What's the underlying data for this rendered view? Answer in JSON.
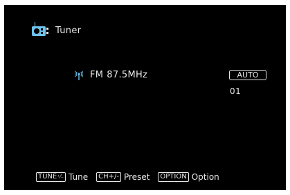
{
  "header": {
    "title": "Tuner",
    "icon": "radio-icon"
  },
  "station": {
    "band": "FM",
    "frequency": "87.5MHz",
    "icon": "antenna-icon"
  },
  "tuning": {
    "mode": "AUTO",
    "preset_number": "01"
  },
  "footer": {
    "tune_key": "TUNE",
    "tune_label": "Tune",
    "preset_key": "CH+/-",
    "preset_label": "Preset",
    "option_key": "OPTION",
    "option_label": "Option"
  },
  "colors": {
    "background": "#000000",
    "text": "#e8e8e8",
    "accent": "#6fc3ee"
  }
}
